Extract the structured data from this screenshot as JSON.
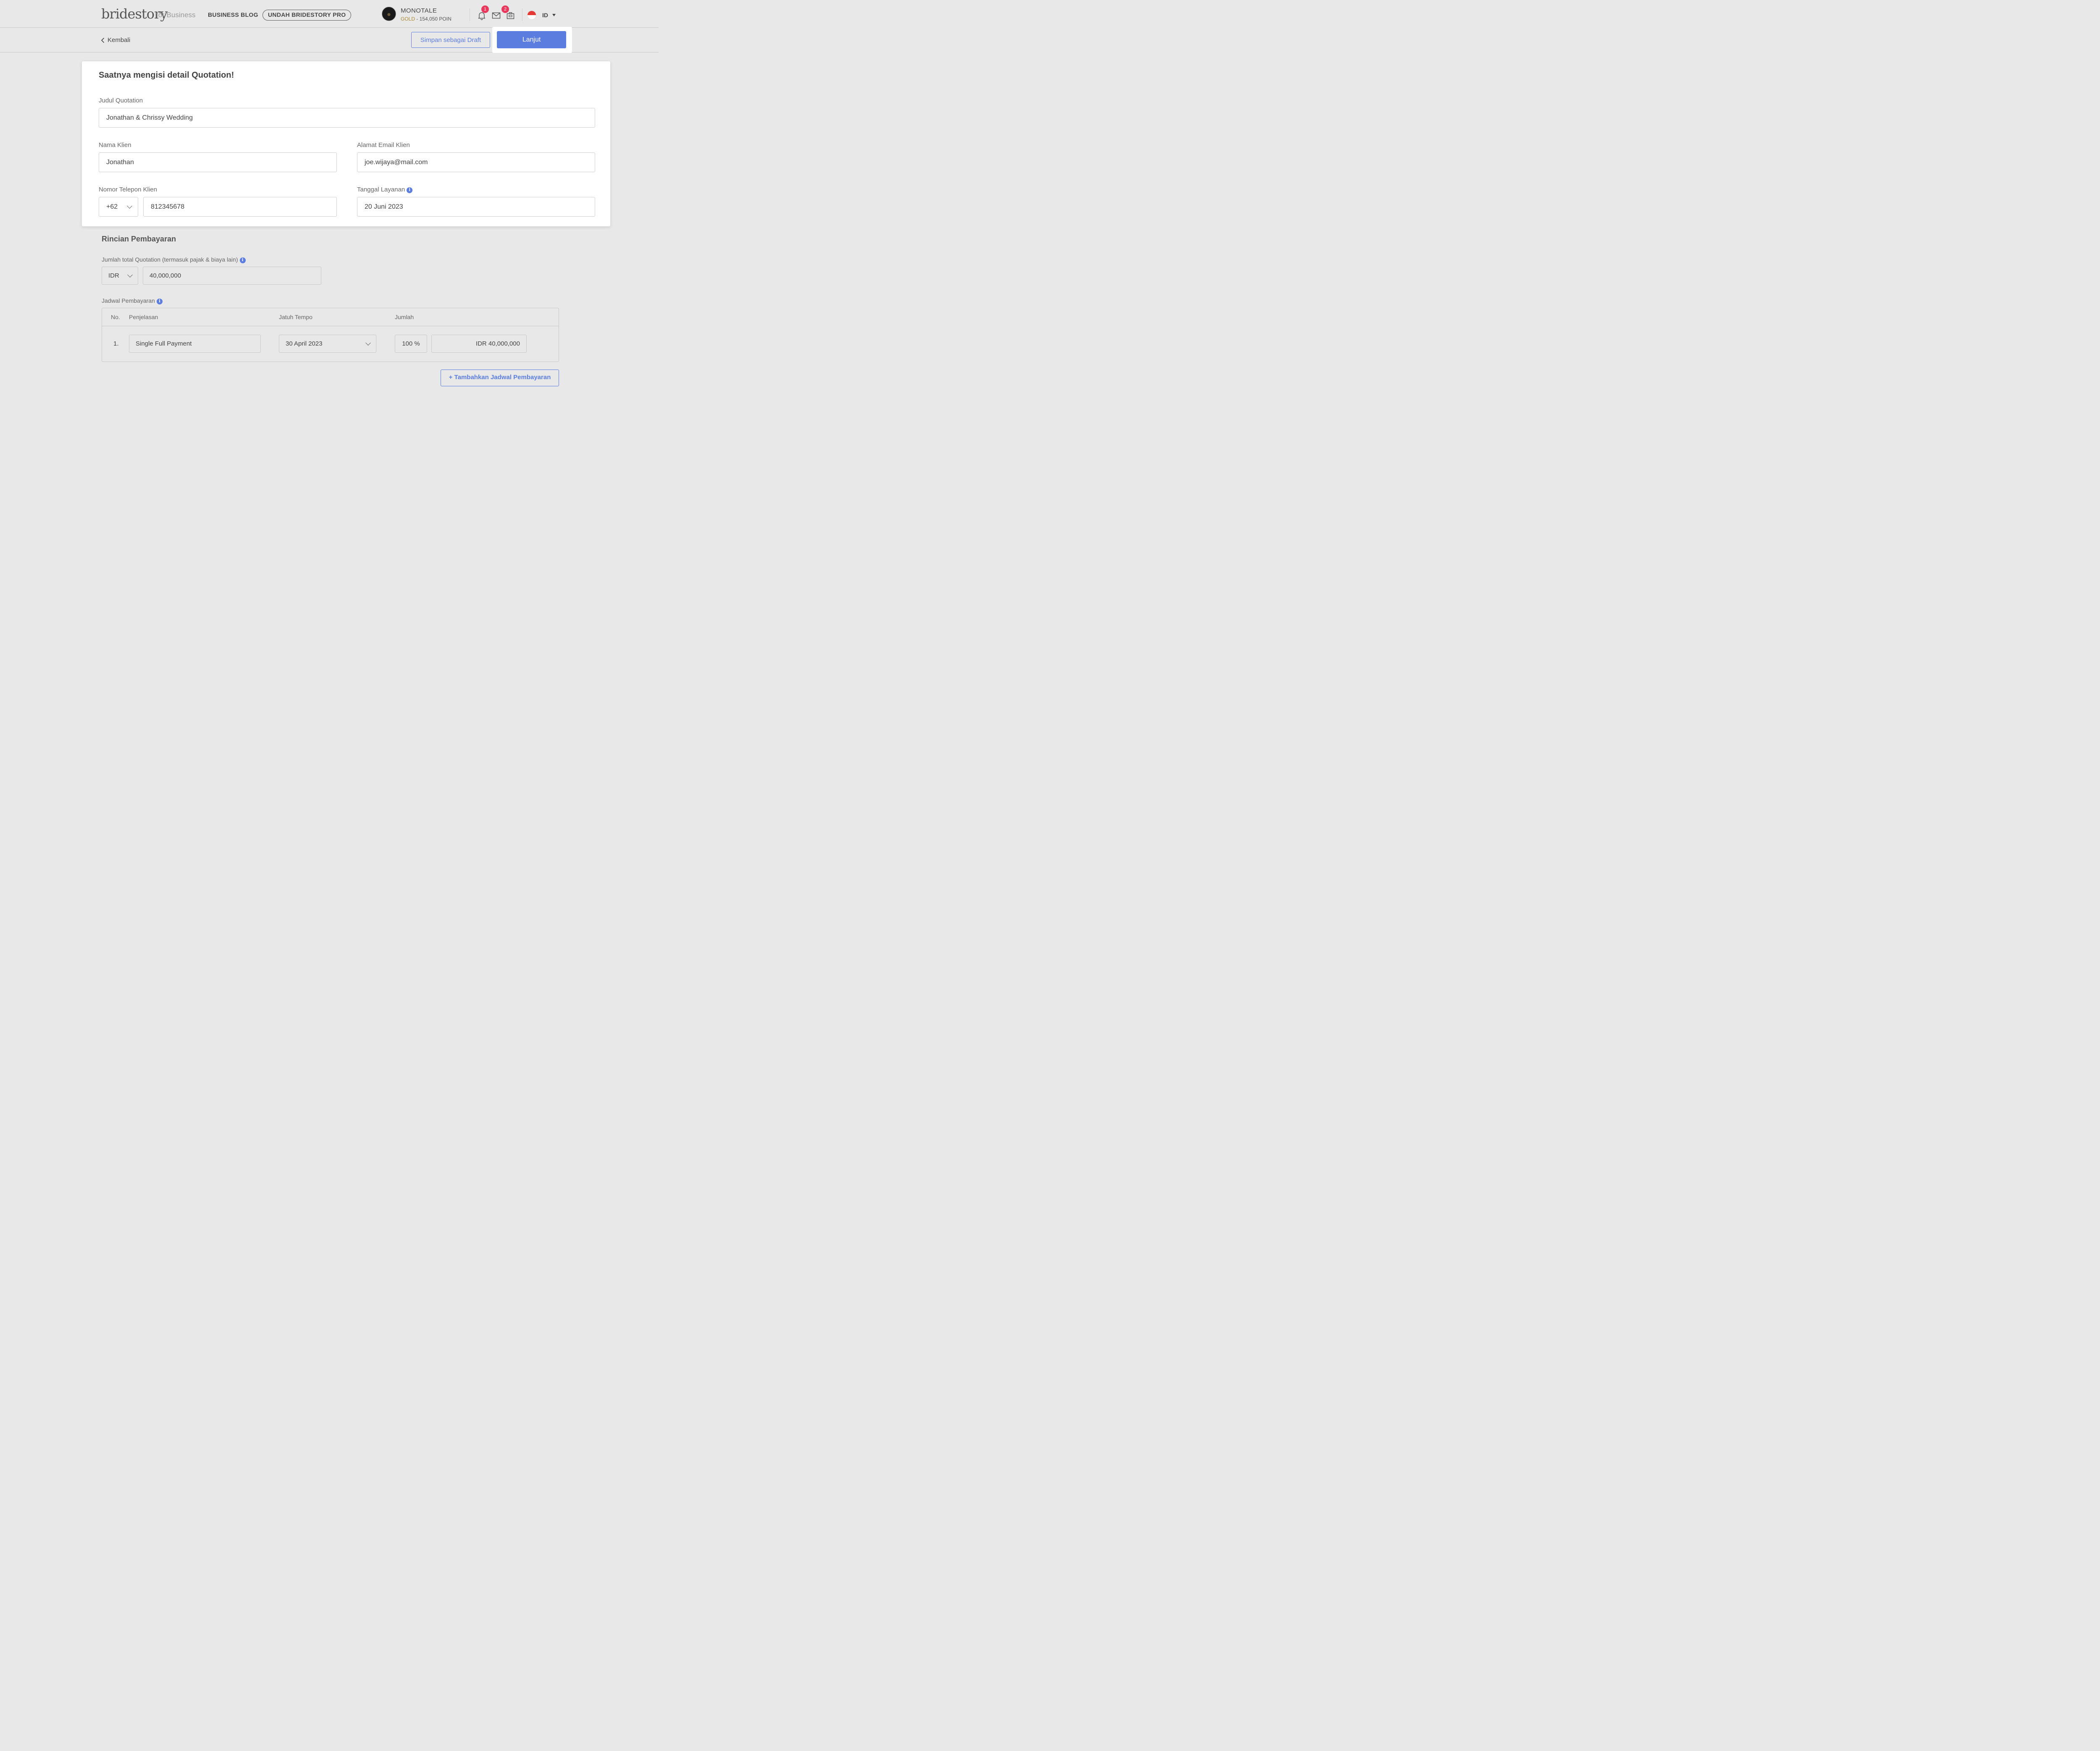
{
  "header": {
    "logo": "bridestory",
    "logo_sub": "for Business",
    "blog": "BUSINESS BLOG",
    "pro": "UNDAH BRIDESTORY PRO",
    "vendor_name": "MONOTALE",
    "tier": "GOLD",
    "points": " - 154,050 POIN",
    "notif_count": "1",
    "message_count": "2",
    "lang": "ID",
    "icons": [
      "bell-icon",
      "mail-icon",
      "briefcase-icon"
    ]
  },
  "subbar": {
    "back": "Kembali",
    "draft": "Simpan sebagai Draft",
    "next": "Lanjut"
  },
  "form": {
    "title": "Saatnya mengisi detail Quotation!",
    "judul_label": "Judul Quotation",
    "judul_value": "Jonathan & Chrissy Wedding",
    "nama_label": "Nama Klien",
    "nama_value": "Jonathan",
    "email_label": "Alamat Email Klien",
    "email_value": "joe.wijaya@mail.com",
    "phone_label": "Nomor Telepon Klien",
    "phone_code": "+62",
    "phone_value": "812345678",
    "date_label": "Tanggal Layanan",
    "date_value": "20 Juni 2023"
  },
  "payment": {
    "title": "Rincian Pembayaran",
    "total_label": "Jumlah total Quotation (termasuk pajak & biaya lain)",
    "currency": "IDR",
    "total_value": "40,000,000",
    "schedule_label": "Jadwal Pembayaran",
    "columns": [
      "No.",
      "Penjelasan",
      "Jatuh Tempo",
      "Jumlah"
    ],
    "rows": [
      {
        "no": "1.",
        "desc": "Single Full Payment",
        "due": "30 April 2023",
        "percent": "100 %",
        "amount": "IDR 40,000,000"
      }
    ],
    "add_button": "+ Tambahkan Jadwal Pembayaran"
  },
  "colors": {
    "accent": "#5b7de0",
    "badge": "#e8395c",
    "gold": "#a8892f"
  }
}
